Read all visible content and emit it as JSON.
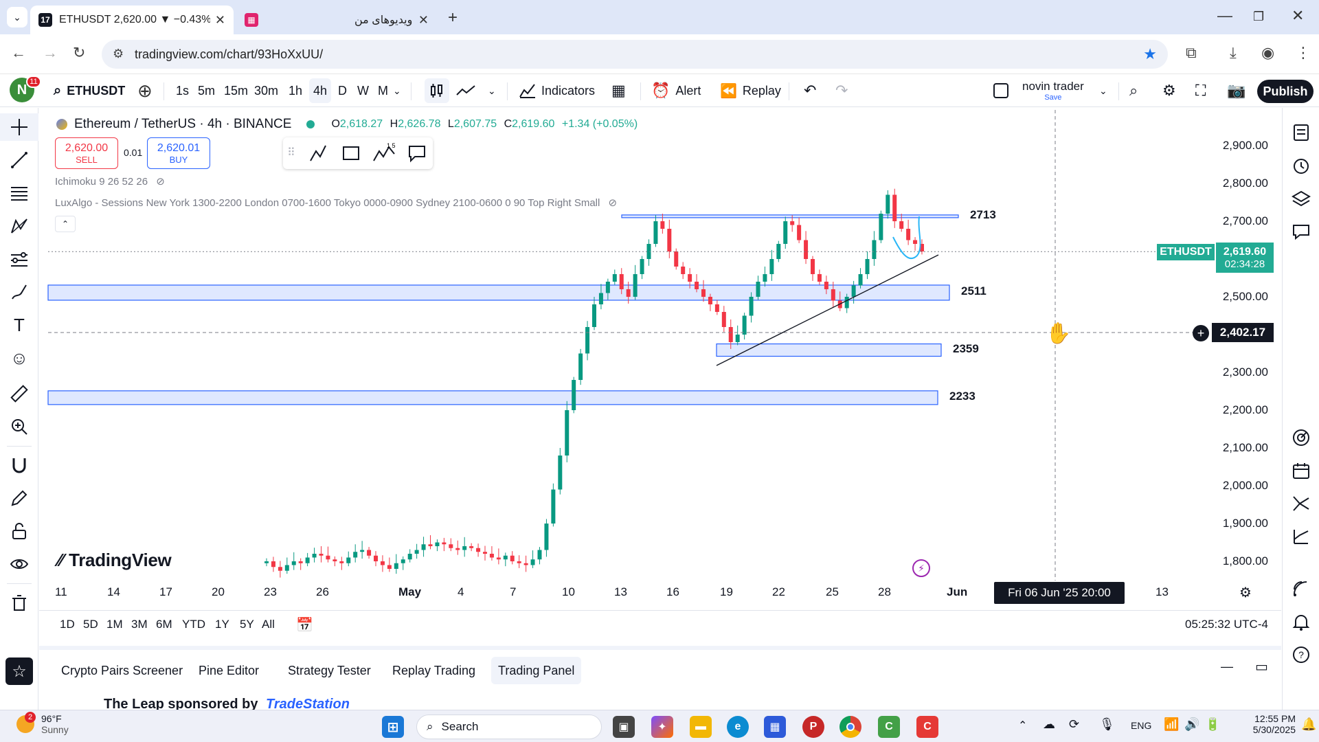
{
  "browser": {
    "tabs": [
      {
        "title": "ETHUSDT 2,620.00 ▼ −0.43% n"
      },
      {
        "title": "ویدیوهای من"
      }
    ],
    "url": "tradingview.com/chart/93HoXxUU/"
  },
  "toolbar": {
    "avatar_letter": "N",
    "notifications": "11",
    "symbol": "ETHUSDT",
    "intervals": [
      "1s",
      "5m",
      "15m",
      "30m",
      "1h",
      "4h",
      "D",
      "W",
      "M"
    ],
    "selected_interval": "4h",
    "indicators_label": "Indicators",
    "alert_label": "Alert",
    "replay_label": "Replay",
    "layout_name": "novin trader",
    "layout_save": "Save",
    "publish_label": "Publish"
  },
  "legend": {
    "title": "Ethereum / TetherUS · 4h · BINANCE",
    "o_label": "O",
    "o": "2,618.27",
    "h_label": "H",
    "h": "2,626.78",
    "l_label": "L",
    "l": "2,607.75",
    "c_label": "C",
    "c": "2,619.60",
    "change": "+1.34 (+0.05%)",
    "sell_price": "2,620.00",
    "sell_label": "SELL",
    "spread": "0.01",
    "buy_price": "2,620.01",
    "buy_label": "BUY",
    "ichimoku": "Ichimoku 9 26 52 26",
    "luxalgo": "LuxAlgo - Sessions New York 1300-2200 London 0700-1600 Tokyo 0000-0900 Sydney 2100-0600 0 90 Top Right Small"
  },
  "chart_data": {
    "type": "candlestick",
    "symbol": "ETHUSDT",
    "interval": "4h",
    "y_ticks": [
      "2,900.00",
      "2,800.00",
      "2,700.00",
      "2,500.00",
      "2,300.00",
      "2,200.00",
      "2,100.00",
      "2,000.00",
      "1,900.00",
      "1,800.00"
    ],
    "ylim": [
      1745,
      2930
    ],
    "x_ticks": [
      "11",
      "14",
      "17",
      "20",
      "23",
      "26",
      "May",
      "4",
      "7",
      "10",
      "13",
      "16",
      "19",
      "22",
      "25",
      "28",
      "Jun",
      "13"
    ],
    "levels": [
      {
        "label": "2713",
        "price": 2713
      },
      {
        "label": "2511",
        "price": 2511
      },
      {
        "label": "2359",
        "price": 2359
      },
      {
        "label": "2233",
        "price": 2233
      }
    ],
    "last_price": {
      "symbol": "ETHUSDT",
      "price": 2619.6,
      "label": "2,619.60",
      "countdown": "02:34:28"
    },
    "crosshair_price": "2,402.17",
    "crosshair_time": "Fri 06 Jun '25   20:00",
    "closes": [
      1800,
      1785,
      1775,
      1790,
      1800,
      1795,
      1810,
      1820,
      1815,
      1805,
      1800,
      1795,
      1810,
      1825,
      1830,
      1815,
      1800,
      1790,
      1780,
      1795,
      1805,
      1820,
      1830,
      1845,
      1840,
      1850,
      1845,
      1835,
      1830,
      1840,
      1835,
      1825,
      1820,
      1810,
      1805,
      1815,
      1800,
      1795,
      1790,
      1805,
      1830,
      1900,
      1990,
      2080,
      2200,
      2280,
      2350,
      2420,
      2480,
      2510,
      2540,
      2560,
      2520,
      2500,
      2560,
      2600,
      2640,
      2700,
      2680,
      2620,
      2580,
      2560,
      2540,
      2520,
      2500,
      2480,
      2460,
      2420,
      2380,
      2400,
      2450,
      2500,
      2540,
      2560,
      2600,
      2640,
      2700,
      2690,
      2650,
      2600,
      2560,
      2540,
      2520,
      2490,
      2470,
      2500,
      2530,
      2560,
      2600,
      2650,
      2720,
      2770,
      2700,
      2680,
      2650,
      2640,
      2620
    ]
  },
  "range": [
    "1D",
    "5D",
    "1M",
    "3M",
    "6M",
    "YTD",
    "1Y",
    "5Y",
    "All"
  ],
  "clock_status": "05:25:32 UTC-4",
  "panels": [
    "Crypto Pairs Screener",
    "Pine Editor",
    "Strategy Tester",
    "Replay Trading",
    "Trading Panel"
  ],
  "panel_selected": "Trading Panel",
  "panel_text": "The Leap sponsored by",
  "panel_brand": "TradeStation",
  "logo_text": "TradingView",
  "taskbar": {
    "weather_temp": "96°F",
    "weather_desc": "Sunny",
    "weather_badge": "2",
    "search": "Search",
    "lang": "ENG",
    "time": "12:55 PM",
    "date": "5/30/2025"
  }
}
